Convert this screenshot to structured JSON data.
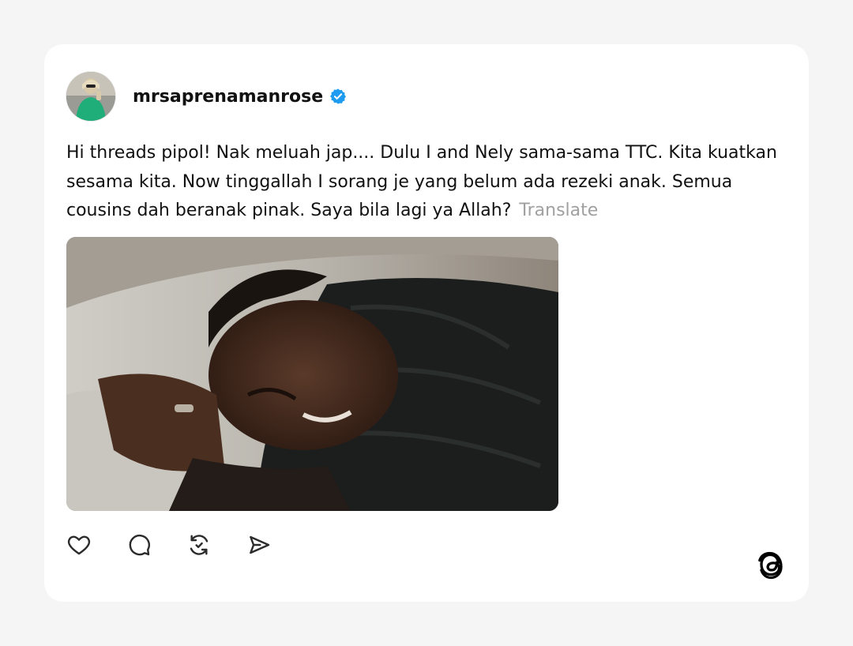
{
  "post": {
    "username": "mrsaprenamanrose",
    "verified": true,
    "text": "Hi threads pipol! Nak meluah jap.... Dulu I and Nely sama-sama TTC. Kita kuatkan sesama kita. Now tinggallah I sorang je yang belum ada rezeki anak. Semua cousins dah beranak pinak. Saya bila lagi ya Allah?",
    "translate_label": "Translate"
  },
  "actions": {
    "like": "heart-icon",
    "reply": "comment-icon",
    "repost": "repost-icon",
    "share": "share-icon"
  },
  "brand": {
    "logo": "threads-logo-icon",
    "verified_color": "#1d9bf0"
  }
}
